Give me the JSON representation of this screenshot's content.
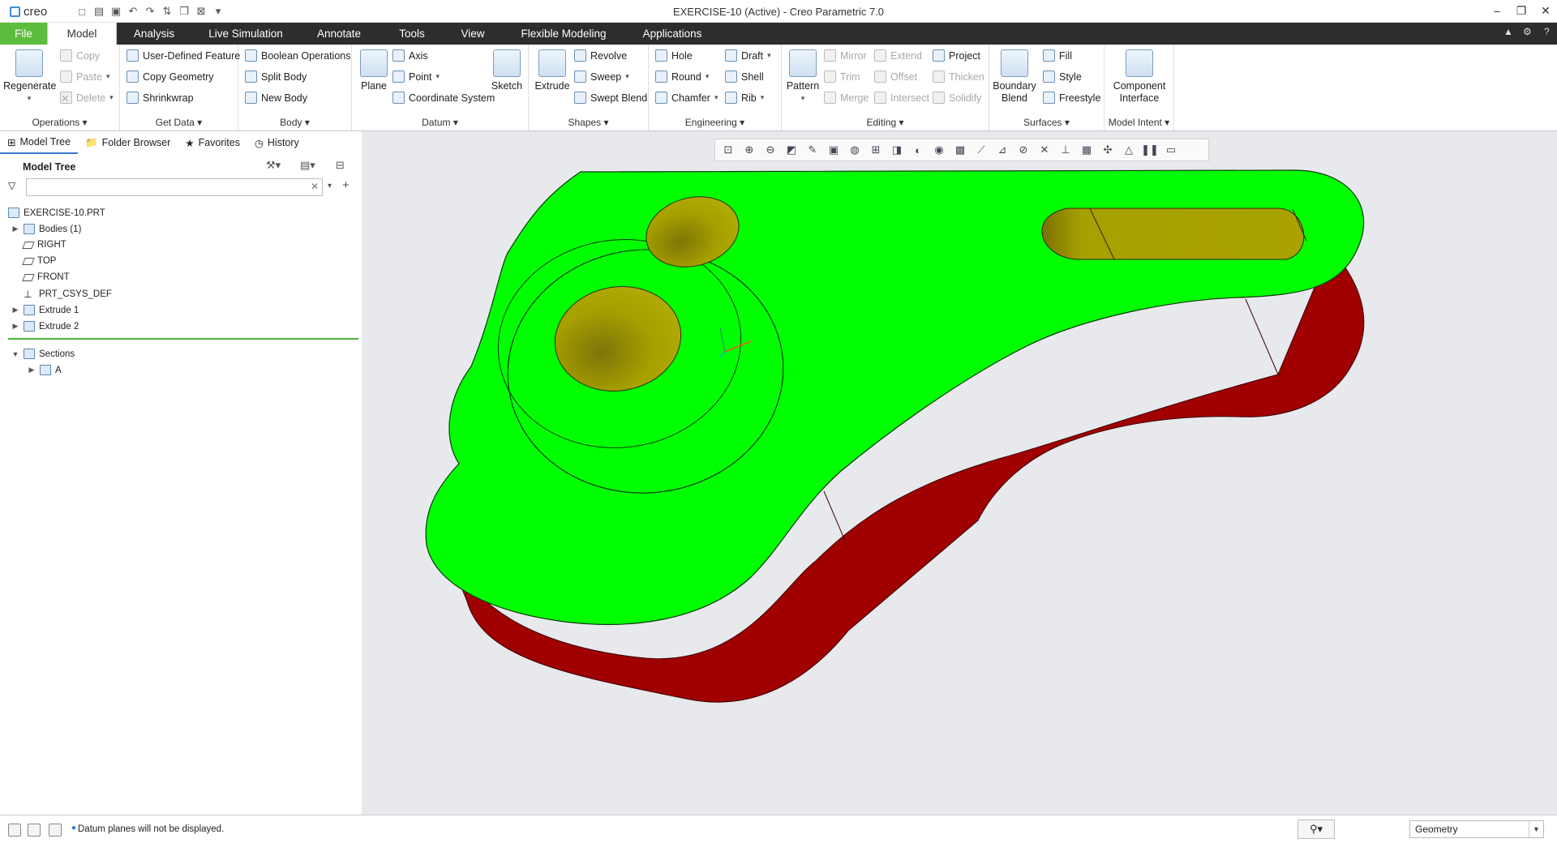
{
  "app": {
    "logo_text": "creo",
    "window_title": "EXERCISE-10 (Active) - Creo Parametric 7.0"
  },
  "quick_access": [
    "new-icon",
    "open-icon",
    "save-icon",
    "undo-icon",
    "redo-icon",
    "regenerate-icon",
    "windows-icon",
    "close-window-icon"
  ],
  "window_controls": [
    "minimize-icon",
    "restore-icon",
    "close-icon"
  ],
  "menu": {
    "tabs": [
      "File",
      "Model",
      "Analysis",
      "Live Simulation",
      "Annotate",
      "Tools",
      "View",
      "Flexible Modeling",
      "Applications"
    ],
    "active": "Model"
  },
  "ribbon": {
    "operations": {
      "label": "Operations",
      "regenerate": "Regenerate",
      "copy": "Copy",
      "paste": "Paste",
      "delete": "Delete"
    },
    "get_data": {
      "label": "Get Data",
      "udf": "User-Defined Feature",
      "copy_geometry": "Copy Geometry",
      "shrinkwrap": "Shrinkwrap"
    },
    "body": {
      "label": "Body",
      "boolean": "Boolean Operations",
      "split": "Split Body",
      "new": "New Body"
    },
    "datum": {
      "label": "Datum",
      "plane": "Plane",
      "axis": "Axis",
      "point": "Point",
      "csys": "Coordinate System",
      "sketch": "Sketch"
    },
    "shapes": {
      "label": "Shapes",
      "extrude": "Extrude",
      "revolve": "Revolve",
      "sweep": "Sweep",
      "swept_blend": "Swept Blend"
    },
    "engineering": {
      "label": "Engineering",
      "hole": "Hole",
      "round": "Round",
      "chamfer": "Chamfer",
      "draft": "Draft",
      "shell": "Shell",
      "rib": "Rib"
    },
    "editing": {
      "label": "Editing",
      "pattern": "Pattern",
      "mirror": "Mirror",
      "trim": "Trim",
      "merge": "Merge",
      "extend": "Extend",
      "offset": "Offset",
      "intersect": "Intersect",
      "project": "Project",
      "thicken": "Thicken",
      "solidify": "Solidify"
    },
    "surfaces": {
      "label": "Surfaces",
      "boundary_blend": "Boundary\nBlend",
      "fill": "Fill",
      "style": "Style",
      "freestyle": "Freestyle"
    },
    "model_intent": {
      "label": "Model Intent",
      "component_interface": "Component\nInterface"
    }
  },
  "nav_tabs": [
    "Model Tree",
    "Folder Browser",
    "Favorites",
    "History"
  ],
  "model_tree": {
    "title": "Model Tree",
    "search_placeholder": "",
    "root": "EXERCISE-10.PRT",
    "items": [
      "Bodies (1)",
      "RIGHT",
      "TOP",
      "FRONT",
      "PRT_CSYS_DEF",
      "Extrude 1",
      "Extrude 2"
    ],
    "sections_label": "Sections",
    "sections": [
      "A"
    ]
  },
  "status": {
    "message": "Datum planes will not be displayed.",
    "filter_value": "Geometry"
  },
  "colors": {
    "accent_green": "#5bbd3b",
    "model_top": "#00ff00",
    "model_side": "#a00000",
    "hole": "#a6a000",
    "viewport_bg": "#e7e9ec"
  }
}
